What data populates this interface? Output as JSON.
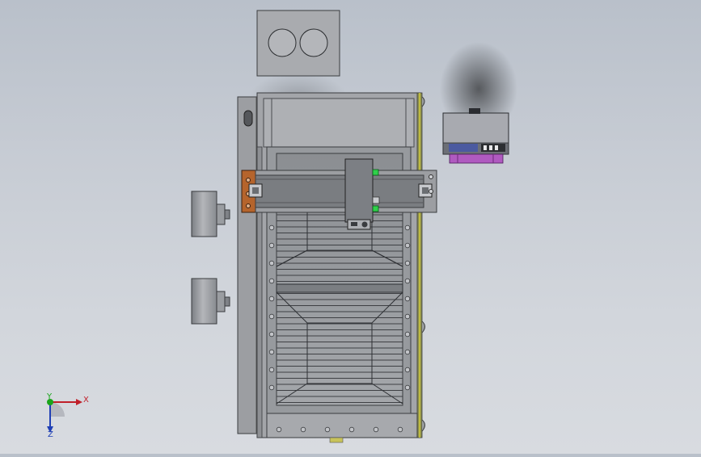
{
  "triad": {
    "x_label": "X",
    "y_label": "Y",
    "z_label": "Z",
    "x_color": "#c0202a",
    "y_color": "#1aa51a",
    "z_color": "#1f3fb5"
  },
  "colors": {
    "background_top": "#b9c0ca",
    "background_bottom": "#d8dbe0",
    "metal_light": "#a9abaf",
    "metal_dark": "#6e7176",
    "bracket_orange": "#b5642c",
    "motor_purple": "#b05ac0",
    "sensor_green": "#2fd14a",
    "rail_yellow": "#c9c43a"
  },
  "components": [
    "top-motor-box",
    "left-cylinder-upper",
    "left-cylinder-lower",
    "main-frame",
    "gantry-beam",
    "carriage",
    "control-box",
    "bottom-hopper"
  ]
}
